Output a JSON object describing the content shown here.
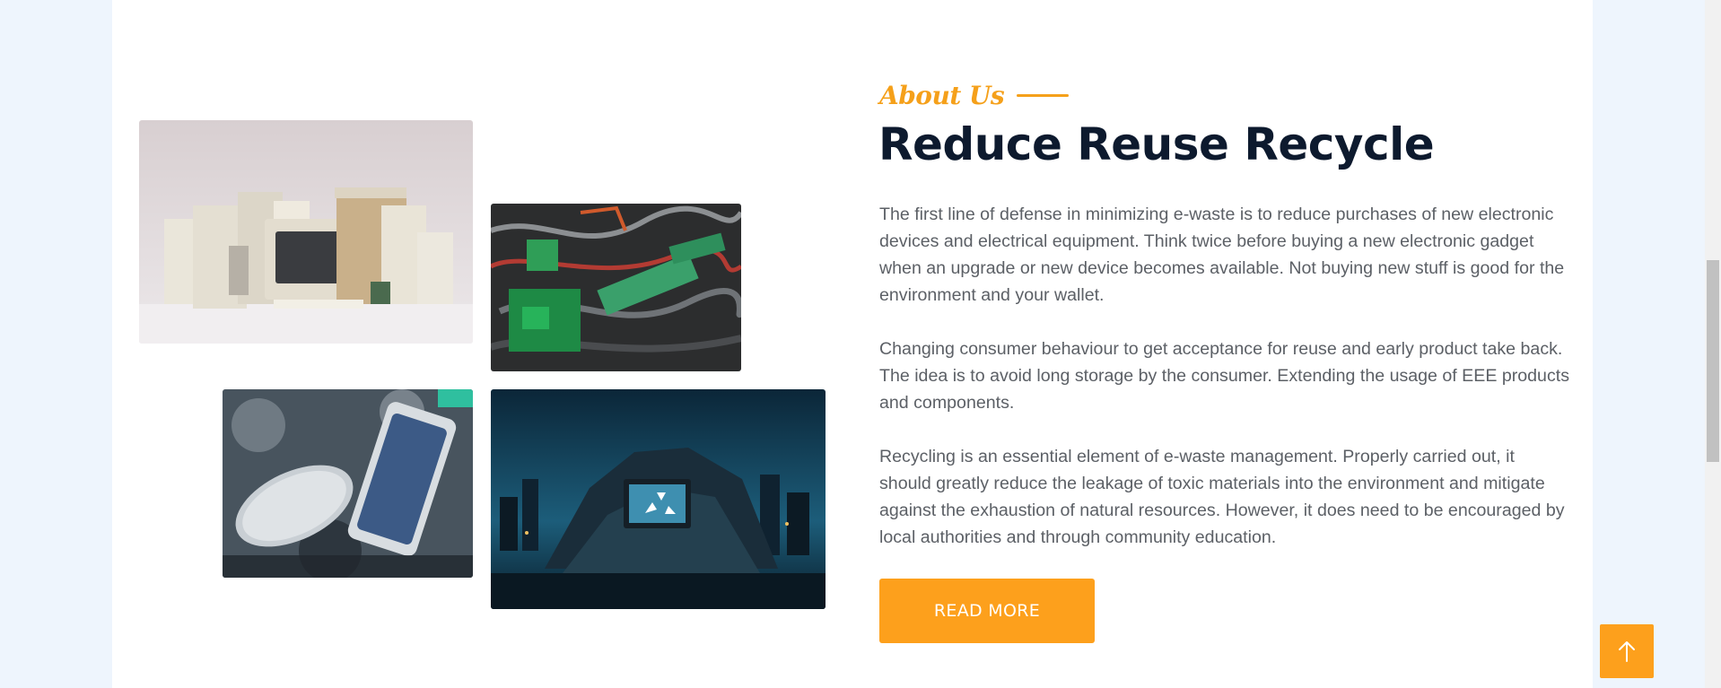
{
  "about": {
    "eyebrow": "About Us",
    "headline": "Reduce Reuse Recycle",
    "paragraphs": [
      "The first line of defense in minimizing e-waste is to reduce purchases of new electronic devices and electrical equipment. Think twice before buying a new electronic gadget when an upgrade or new device becomes available. Not buying new stuff is good for the environment and your wallet.",
      "Changing consumer behaviour to get acceptance for reuse and early product take back. The idea is to avoid long storage by the consumer. Extending the usage of EEE products and components.",
      "Recycling is an essential element of e-waste management. Properly carried out, it should greatly reduce the leakage of toxic materials into the environment and mitigate against the exhaustion of natural resources. However, it does need to be encouraged by local authorities and through community education."
    ],
    "button_label": "READ MORE"
  },
  "scroll_top": {
    "icon": "arrow-up-icon"
  },
  "colors": {
    "accent": "#fda01c",
    "heading": "#0d1a2e",
    "body_text": "#5c6066",
    "page_background": "#eef5fd"
  }
}
